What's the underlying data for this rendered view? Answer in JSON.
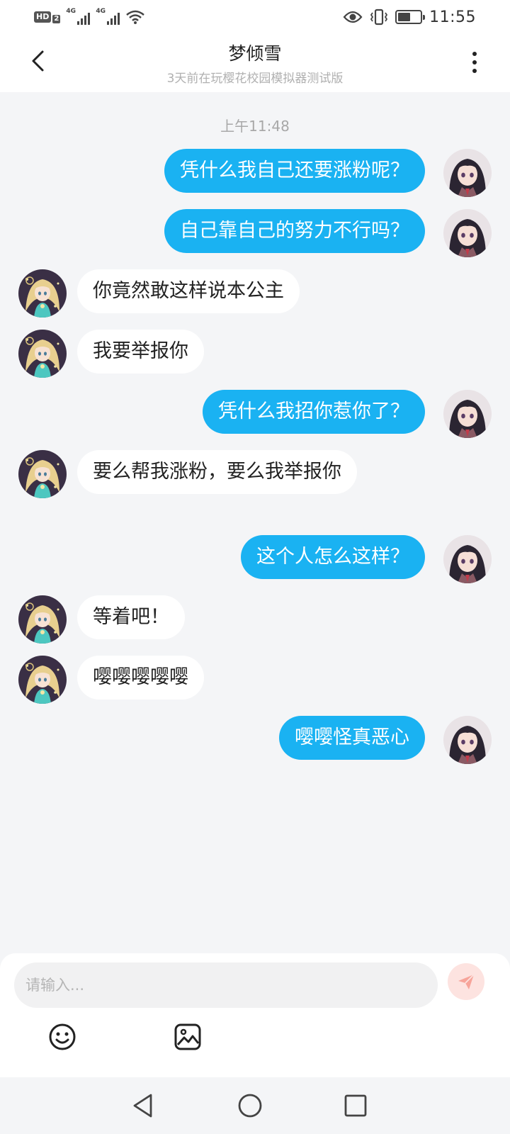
{
  "status_bar": {
    "hd_label": "HD",
    "hd_sub": "2",
    "network_1": "4G",
    "network_2": "4G",
    "time": "11:55",
    "battery_level": 0.55
  },
  "header": {
    "title": "梦倾雪",
    "subtitle": "3天前在玩樱花校园模拟器测试版"
  },
  "chat": {
    "timestamp": "上午11:48",
    "messages": [
      {
        "side": "me",
        "text": "凭什么我自己还要涨粉呢？"
      },
      {
        "side": "me",
        "text": "自己靠自己的努力不行吗？"
      },
      {
        "side": "other",
        "text": "你竟然敢这样说本公主"
      },
      {
        "side": "other",
        "text": "我要举报你"
      },
      {
        "side": "me",
        "text": "凭什么我招你惹你了？"
      },
      {
        "side": "other",
        "text": "要么帮我涨粉，要么我举报你"
      },
      {
        "side": "me",
        "text": "这个人怎么这样？"
      },
      {
        "side": "other",
        "text": "等着吧！"
      },
      {
        "side": "other",
        "text": "嘤嘤嘤嘤嘤"
      },
      {
        "side": "me",
        "text": "嘤嘤怪真恶心"
      }
    ]
  },
  "composer": {
    "placeholder": "请输入...",
    "value": ""
  },
  "icons": {
    "back": "back-arrow-icon",
    "more": "more-vertical-icon",
    "send": "send-icon",
    "emoji": "emoji-icon",
    "image": "image-icon"
  },
  "colors": {
    "my_bubble": "#1ab2f2",
    "other_bubble": "#ffffff",
    "background": "#f4f5f7",
    "send_button": "#fde3e0",
    "send_icon": "#f7a49a"
  }
}
